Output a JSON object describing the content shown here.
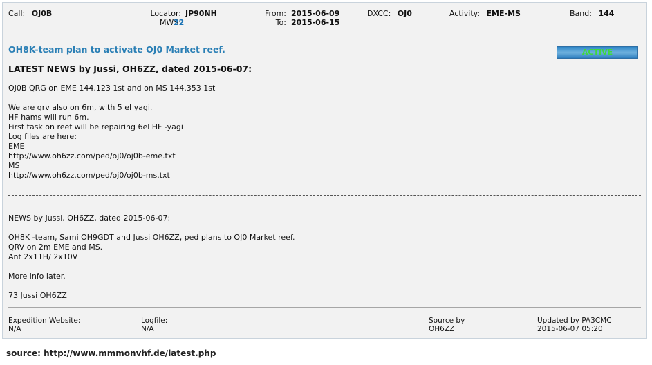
{
  "header": {
    "call_label": "Call:",
    "call_value": "OJ0B",
    "locator_label": "Locator:",
    "locator_value": "JP90NH",
    "mws_label": "MWS:",
    "mws_value": "22",
    "from_label": "From:",
    "from_value": "2015-06-09",
    "to_label": "To:",
    "to_value": "2015-06-15",
    "dxcc_label": "DXCC:",
    "dxcc_value": "OJ0",
    "activity_label": "Activity:",
    "activity_value": "EME-MS",
    "band_label": "Band:",
    "band_value": "144"
  },
  "title": "OH8K-team plan to activate OJ0 Market reef.",
  "status_badge": "ACTIVE",
  "latest_news_heading": "LATEST NEWS by Jussi, OH6ZZ, dated 2015-06-07:",
  "latest_news_lines": {
    "l1": "OJ0B QRG on EME 144.123 1st and on MS 144.353 1st",
    "l2": "We are qrv also on 6m, with 5 el yagi.",
    "l3": "HF hams will run 6m.",
    "l4": "First task on reef will be repairing 6el HF -yagi",
    "l5": "Log files are here:",
    "l6": "EME",
    "l7": "http://www.oh6zz.com/ped/oj0/oj0b-eme.txt",
    "l8": "MS",
    "l9": "http://www.oh6zz.com/ped/oj0/oj0b-ms.txt"
  },
  "news_lines": {
    "l1": "NEWS by Jussi, OH6ZZ, dated 2015-06-07:",
    "l2": "OH8K -team, Sami OH9GDT and Jussi OH6ZZ, ped plans to OJ0 Market reef.",
    "l3": "QRV on 2m EME and MS.",
    "l4": "Ant 2x11H/ 2x10V",
    "l5": "More info later.",
    "l6": "73 Jussi OH6ZZ"
  },
  "footer": {
    "website_label": "Expedition Website:",
    "website_value": "N/A",
    "logfile_label": "Logfile:",
    "logfile_value": "N/A",
    "source_label": "Source by",
    "source_value": "OH6ZZ",
    "updated_label": "Updated by PA3CMC",
    "updated_value": "2015-06-07 05:20"
  },
  "caption": "source: http://www.mmmonvhf.de/latest.php",
  "colors": {
    "panel_bg": "#f2f2f2",
    "title": "#2a7fb5",
    "link": "#1a73b5",
    "badge_bg": "#4a9bd6",
    "badge_text": "#3ed83e"
  }
}
